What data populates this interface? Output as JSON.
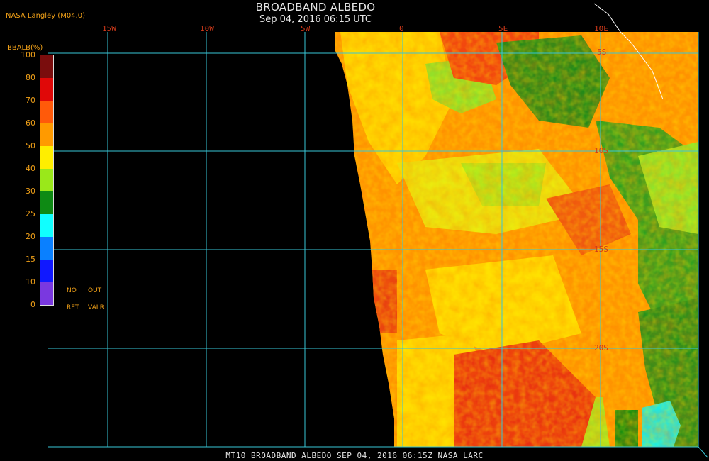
{
  "header": {
    "source": "NASA Langley (M04.0)",
    "title": "BROADBAND ALBEDO",
    "subtitle": "Sep 04, 2016 06:15 UTC"
  },
  "colorbar": {
    "title": "BBALB(%)",
    "ticks": [
      "100",
      "80",
      "70",
      "60",
      "50",
      "40",
      "30",
      "25",
      "20",
      "15",
      "10",
      "0"
    ],
    "colors": [
      "#7a0d0d",
      "#e00808",
      "#ff5a0a",
      "#ff9a00",
      "#ffee00",
      "#9ae81a",
      "#0e8a14",
      "#10ffff",
      "#0a80ff",
      "#1018ff",
      "#7a38e0"
    ],
    "no_ret": "NO",
    "ret": "RET",
    "out": "OUT",
    "valr": "VALR"
  },
  "map": {
    "lon_labels": [
      "15W",
      "10W",
      "5W",
      "0",
      "5E",
      "10E"
    ],
    "lat_labels": [
      "5S",
      "10S",
      "15S",
      "20S"
    ],
    "grid_color": "#39c6d6"
  },
  "footer": "MT10  BROADBAND ALBEDO   SEP 04, 2016 06:15Z   NASA LARC"
}
